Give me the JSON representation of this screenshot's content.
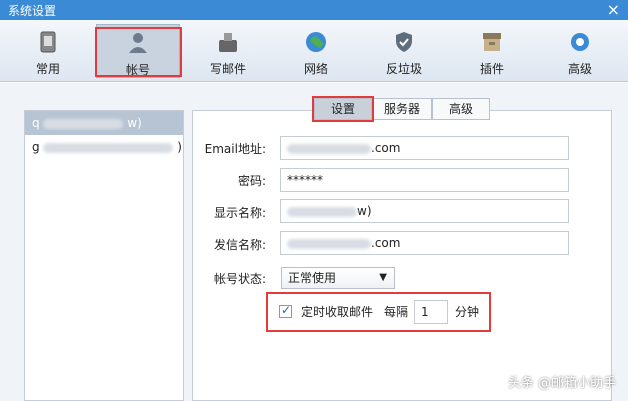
{
  "window": {
    "title": "系统设置",
    "close_icon": "×"
  },
  "toolbar": {
    "items": [
      {
        "label": "常用"
      },
      {
        "label": "帐号"
      },
      {
        "label": "写邮件"
      },
      {
        "label": "网络"
      },
      {
        "label": "反垃圾"
      },
      {
        "label": "插件"
      },
      {
        "label": "高级"
      }
    ]
  },
  "accounts": [
    {
      "display": "q",
      "suffix": "w)"
    },
    {
      "display": "g",
      "suffix": ")"
    }
  ],
  "tabs": [
    {
      "label": "设置"
    },
    {
      "label": "服务器"
    },
    {
      "label": "高级"
    }
  ],
  "form": {
    "email_label": "Email地址:",
    "email_value_suffix": ".com",
    "password_label": "密码:",
    "password_value": "******",
    "display_name_label": "显示名称:",
    "display_name_suffix": "w)",
    "sender_label": "发信名称:",
    "sender_suffix": ".com",
    "status_label": "帐号状态:",
    "status_value": "正常使用",
    "schedule_check_label": "定时收取邮件",
    "interval_prefix": "每隔",
    "interval_value": "1",
    "interval_unit": "分钟"
  },
  "watermark": "头条 @邮箱小助手",
  "colors": {
    "titlebar": "#3a8ad6",
    "highlight_box": "#e23b3b",
    "selected_item": "#b7c4d4"
  }
}
